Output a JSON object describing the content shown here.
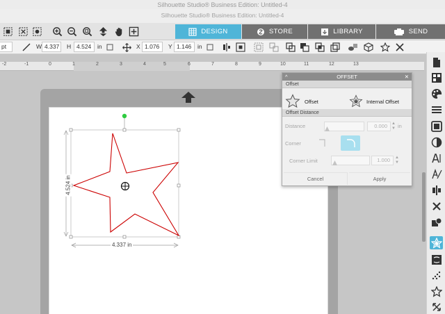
{
  "window": {
    "outer_title": "Silhouette Studio® Business Edition: Untitled-4",
    "inner_title": "Silhouette Studio® Business Edition: Untitled-4"
  },
  "tabs": [
    {
      "label": "DESIGN",
      "active": true
    },
    {
      "label": "STORE",
      "active": false
    },
    {
      "label": "LIBRARY",
      "active": false
    },
    {
      "label": "SEND",
      "active": false
    }
  ],
  "properties": {
    "line_unit": "pt",
    "w_label": "W",
    "w_value": "4.337",
    "h_label": "H",
    "h_value": "4.524",
    "size_unit": "in",
    "x_label": "X",
    "x_value": "1.076",
    "y_label": "Y",
    "y_value": "1.146",
    "pos_unit": "in"
  },
  "ruler": {
    "ticks": [
      "-2",
      "-1",
      "0",
      "1",
      "2",
      "3",
      "4",
      "5",
      "6",
      "7",
      "8",
      "9",
      "10",
      "11",
      "12",
      "13"
    ]
  },
  "shape": {
    "width_label": "4.337 in",
    "height_label": "4.524 in",
    "stroke_color": "#cc0000"
  },
  "offset_panel": {
    "title": "OFFSET",
    "section_offset": "Offset",
    "option_offset": "Offset",
    "option_internal": "Internal Offset",
    "section_distance": "Offset Distance",
    "distance_label": "Distance",
    "distance_value": "0.000",
    "distance_unit": "in",
    "corner_label": "Corner",
    "corner_limit_label": "Corner Limit",
    "corner_limit_value": "1.000",
    "cancel": "Cancel",
    "apply": "Apply"
  },
  "colors": {
    "accent": "#4fb5d8",
    "tab_inactive": "#717171"
  }
}
